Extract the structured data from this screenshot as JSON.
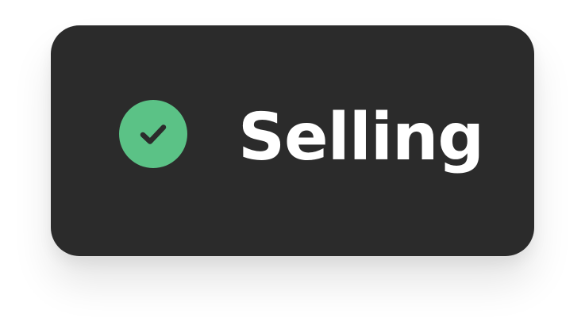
{
  "status": {
    "label": "Selling",
    "icon": "check-circle-icon"
  },
  "colors": {
    "pill_background": "#2b2b2b",
    "label_text": "#ffffff",
    "check_circle": "#5bc286",
    "check_mark": "#2b2b2b"
  }
}
